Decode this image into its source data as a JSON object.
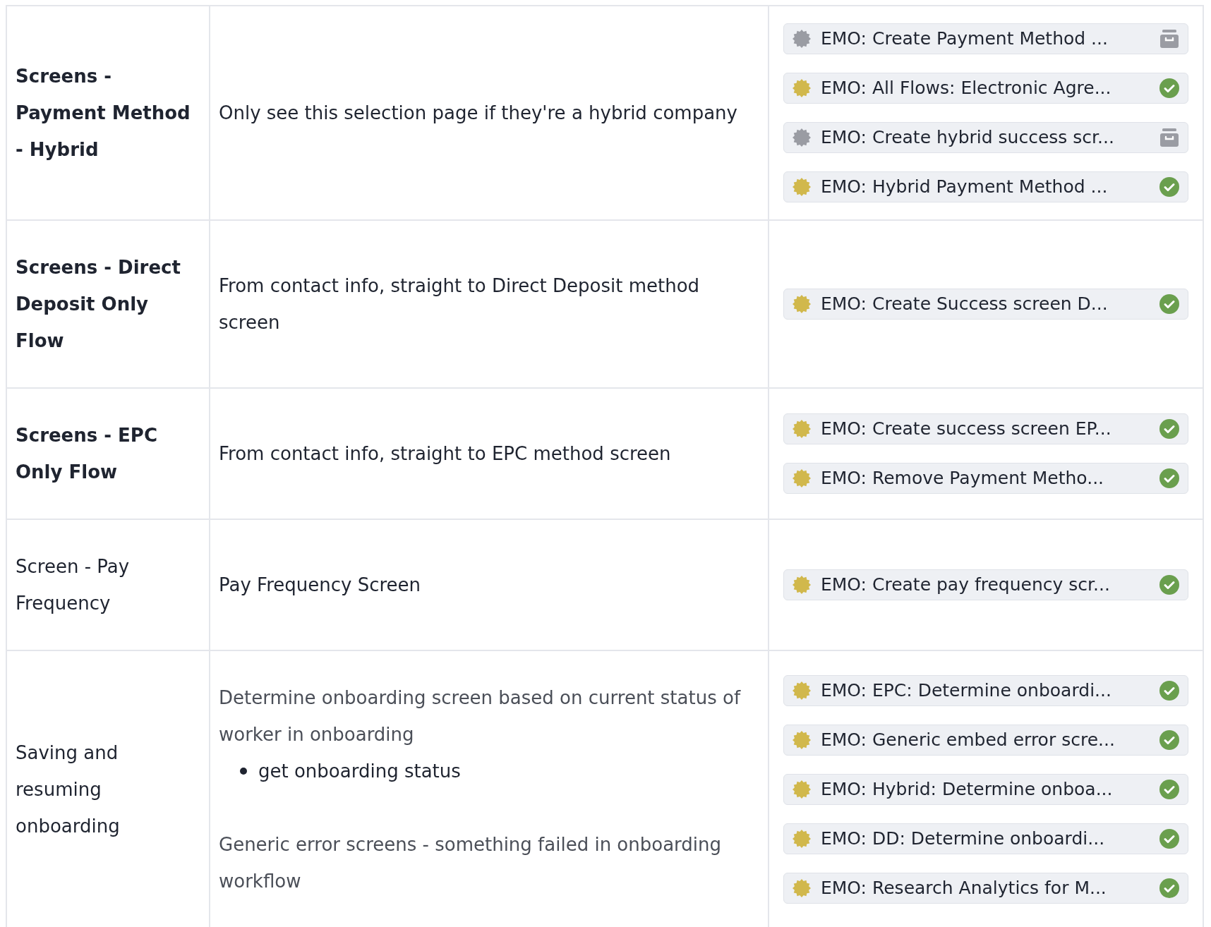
{
  "rows": [
    {
      "name": "Screens - Payment Method - Hybrid",
      "bold": true,
      "description": [
        {
          "kind": "paragraph",
          "muted": false,
          "text": "Only see this selection page if they're a hybrid company"
        }
      ],
      "tasks": [
        {
          "title": "EMO: Create Payment Method ...",
          "kind": "archived"
        },
        {
          "title": "EMO: All Flows: Electronic Agre...",
          "kind": "done"
        },
        {
          "title": "EMO: Create hybrid success scr...",
          "kind": "archived"
        },
        {
          "title": "EMO: Hybrid Payment Method ...",
          "kind": "done"
        }
      ]
    },
    {
      "name": "Screens - Direct Deposit Only Flow",
      "bold": true,
      "description": [
        {
          "kind": "paragraph",
          "muted": false,
          "text": "From contact info, straight to Direct Deposit method screen"
        }
      ],
      "tasks": [
        {
          "title": "EMO: Create Success screen D...",
          "kind": "done"
        }
      ]
    },
    {
      "name": "Screens - EPC Only Flow",
      "bold": true,
      "description": [
        {
          "kind": "paragraph",
          "muted": false,
          "text": "From contact info, straight to EPC method screen"
        }
      ],
      "tasks": [
        {
          "title": "EMO: Create success screen EP...",
          "kind": "done"
        },
        {
          "title": "EMO: Remove Payment Metho...",
          "kind": "done"
        }
      ]
    },
    {
      "name": "Screen - Pay Frequency",
      "bold": false,
      "description": [
        {
          "kind": "paragraph",
          "muted": false,
          "text": "Pay Frequency Screen"
        }
      ],
      "tasks": [
        {
          "title": "EMO: Create pay frequency scr...",
          "kind": "done"
        }
      ]
    },
    {
      "name": "Saving and resuming onboarding",
      "bold": false,
      "description": [
        {
          "kind": "paragraph",
          "muted": true,
          "text": "Determine onboarding screen based on current status of worker in onboarding"
        },
        {
          "kind": "bullet",
          "muted": false,
          "text": "get onboarding status"
        },
        {
          "kind": "paragraph",
          "muted": true,
          "text": "Generic error screens - something failed in onboarding workflow"
        }
      ],
      "tasks": [
        {
          "title": "EMO: EPC: Determine onboardi...",
          "kind": "done"
        },
        {
          "title": "EMO: Generic embed error scre...",
          "kind": "done"
        },
        {
          "title": "EMO: Hybrid: Determine onboa...",
          "kind": "done"
        },
        {
          "title": "EMO: DD: Determine onboardi...",
          "kind": "done"
        },
        {
          "title": "EMO: Research Analytics for M...",
          "kind": "done"
        }
      ]
    }
  ]
}
